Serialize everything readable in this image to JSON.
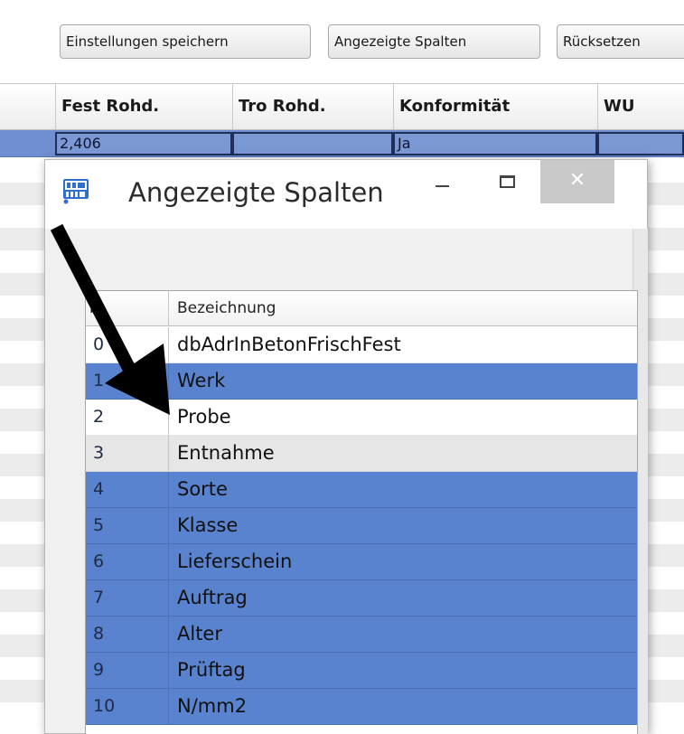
{
  "toolbar": {
    "save_settings_label": "Einstellungen speichern",
    "shown_columns_label": "Angezeigte Spalten",
    "reset_label": "Rücksetzen"
  },
  "grid": {
    "columns": [
      "Fest Rohd.",
      "Tro Rohd.",
      "Konformität",
      "WU"
    ],
    "selected_row": [
      "2,406",
      "",
      "Ja",
      ""
    ]
  },
  "dialog": {
    "title": "Angezeigte Spalten",
    "icon": "app-logo-icon",
    "controls": {
      "minimize_icon": "minimize-icon",
      "maximize_icon": "maximize-icon",
      "close_glyph": "✕"
    },
    "list": {
      "headers": {
        "number": "N",
        "name": "Bezeichnung"
      },
      "rows": [
        {
          "no": "0",
          "name": "dbAdrInBetonFrischFest",
          "state": "normal"
        },
        {
          "no": "1",
          "name": "Werk",
          "state": "selected"
        },
        {
          "no": "2",
          "name": "Probe",
          "state": "normal"
        },
        {
          "no": "3",
          "name": "Entnahme",
          "state": "hover"
        },
        {
          "no": "4",
          "name": "Sorte",
          "state": "selected"
        },
        {
          "no": "5",
          "name": "Klasse",
          "state": "selected"
        },
        {
          "no": "6",
          "name": "Lieferschein",
          "state": "selected"
        },
        {
          "no": "7",
          "name": "Auftrag",
          "state": "selected"
        },
        {
          "no": "8",
          "name": "Alter",
          "state": "selected"
        },
        {
          "no": "9",
          "name": "Prüftag",
          "state": "selected"
        },
        {
          "no": "10",
          "name": "N/mm2",
          "state": "selected"
        }
      ]
    }
  },
  "annotation": {
    "type": "arrow-icon",
    "color": "#000000"
  },
  "colors": {
    "selection": "#5a83cf",
    "grid_selection": "#6f8fd0",
    "hover_row": "#e6e6e6"
  }
}
